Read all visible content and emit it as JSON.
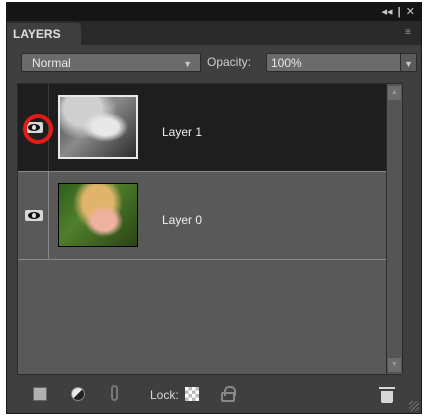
{
  "window": {
    "controls": [
      "◂◂",
      "|",
      "✕"
    ]
  },
  "panel": {
    "tab_title": "LAYERS"
  },
  "toolbar": {
    "blend_mode": "Normal",
    "opacity_label": "Opacity:",
    "opacity_value": "100%"
  },
  "layers": [
    {
      "name": "Layer 1",
      "visible": true,
      "selected": true,
      "highlighted_eye": true,
      "thumbnail": "black-and-white photo of laughing woman"
    },
    {
      "name": "Layer 0",
      "visible": true,
      "selected": false,
      "highlighted_eye": false,
      "thumbnail": "color photo of laughing woman"
    }
  ],
  "bottom_bar": {
    "lock_label": "Lock:"
  },
  "colors": {
    "panel_bg": "#3f3f3f",
    "selected_row": "#1e1e1e",
    "annotation_ring": "#e41b17"
  }
}
